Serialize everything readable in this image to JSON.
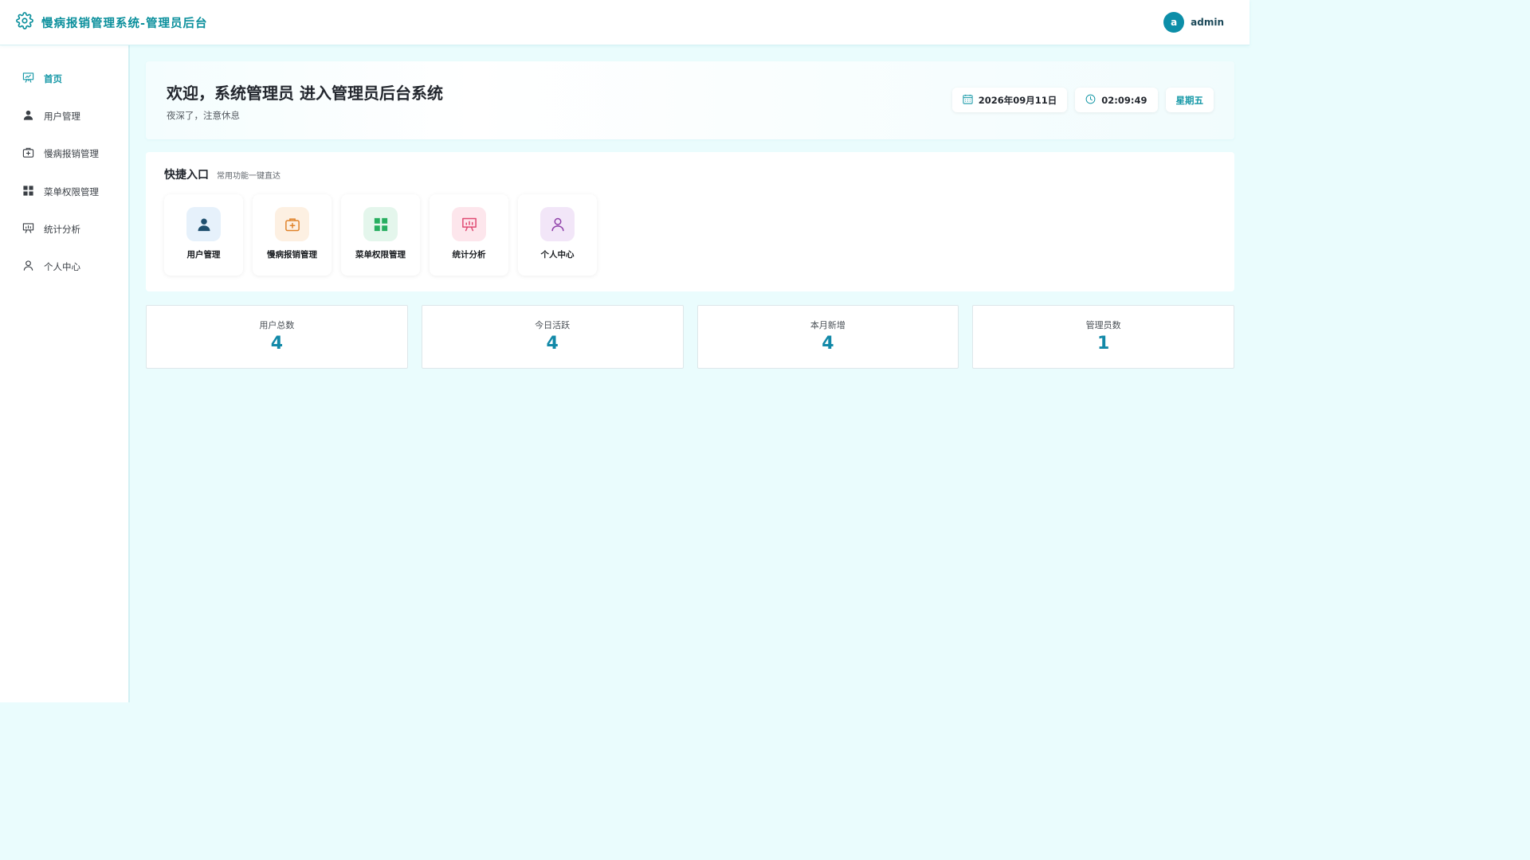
{
  "header": {
    "title": "慢病报销管理系统-管理员后台",
    "icon": "gear-icon",
    "avatar_letter": "a",
    "username": "admin"
  },
  "sidebar": {
    "items": [
      {
        "label": "首页",
        "icon": "presentation-chart-icon",
        "active": true
      },
      {
        "label": "用户管理",
        "icon": "user-icon",
        "active": false
      },
      {
        "label": "慢病报销管理",
        "icon": "medical-case-icon",
        "active": false
      },
      {
        "label": "菜单权限管理",
        "icon": "grid-icon",
        "active": false
      },
      {
        "label": "统计分析",
        "icon": "presentation-chart-icon",
        "active": false
      },
      {
        "label": "个人中心",
        "icon": "user-outline-icon",
        "active": false
      }
    ]
  },
  "welcome": {
    "title": "欢迎，系统管理员 进入管理员后台系统",
    "subtitle": "夜深了，注意休息",
    "date": "2026年09月11日",
    "time": "02:09:49",
    "weekday": "星期五"
  },
  "quick": {
    "title": "快捷入口",
    "subtitle": "常用功能一键直达",
    "items": [
      {
        "label": "用户管理",
        "icon": "user-icon",
        "bg": "#e6f1fb",
        "color": "#1f4f6e"
      },
      {
        "label": "慢病报销管理",
        "icon": "medical-case-icon",
        "bg": "#fdf0e2",
        "color": "#e0832b"
      },
      {
        "label": "菜单权限管理",
        "icon": "grid-icon",
        "bg": "#e4f6ec",
        "color": "#27ae60"
      },
      {
        "label": "统计分析",
        "icon": "presentation-chart-icon",
        "bg": "#fde6ec",
        "color": "#e04a72"
      },
      {
        "label": "个人中心",
        "icon": "user-outline-icon",
        "bg": "#f2e6f8",
        "color": "#8e3ea8"
      }
    ]
  },
  "stats": [
    {
      "label": "用户总数",
      "value": "4"
    },
    {
      "label": "今日活跃",
      "value": "4"
    },
    {
      "label": "本月新增",
      "value": "4"
    },
    {
      "label": "管理员数",
      "value": "1"
    }
  ],
  "colors": {
    "accent": "#1497a6",
    "background": "#eafcfd",
    "stat_value": "#1289a8"
  }
}
